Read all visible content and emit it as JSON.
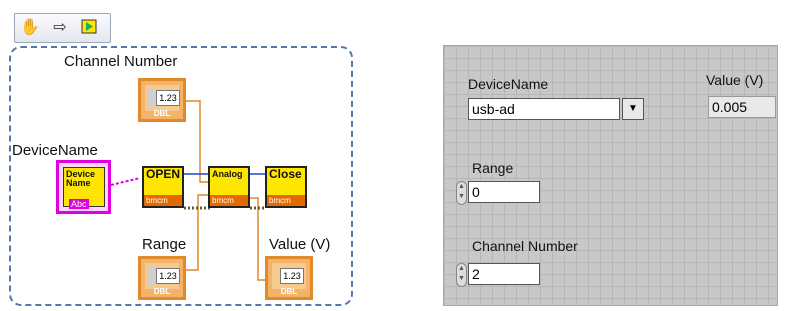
{
  "toolbar": {
    "icons": [
      "hand-icon",
      "arrow-icon",
      "run-icon"
    ]
  },
  "block_diagram": {
    "channel_number_label": "Channel Number",
    "device_name_label": "DeviceName",
    "range_label": "Range",
    "value_label": "Value (V)",
    "dbl_value": "1.23",
    "dbl_tag": "DBL",
    "device_term_text": "Device Name",
    "device_term_type": "Abc",
    "vi_open": "OPEN",
    "vi_analog": "Analog",
    "vi_close": "Close",
    "vi_footer": "bmcm"
  },
  "front_panel": {
    "device_name_label": "DeviceName",
    "device_name_value": "usb-ad",
    "value_label": "Value (V)",
    "value_value": "0.005",
    "range_label": "Range",
    "range_value": "0",
    "channel_label": "Channel Number",
    "channel_value": "2"
  },
  "colors": {
    "numeric_orange": "#e08a2a",
    "string_pink": "#e000e0",
    "vi_yellow": "#ffe600",
    "frame_blue": "#5577aa"
  }
}
